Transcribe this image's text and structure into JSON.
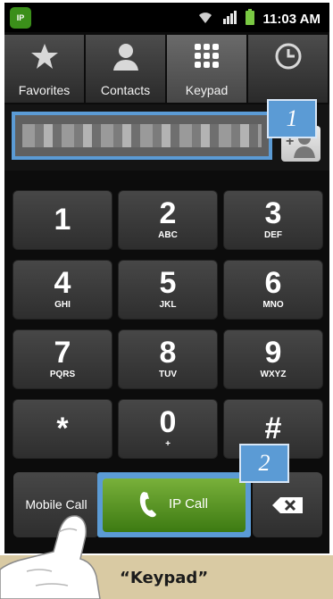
{
  "status_bar": {
    "app_badge": "IP",
    "icons": [
      "wifi-icon",
      "signal-icon",
      "battery-icon"
    ],
    "time": "11:03 AM"
  },
  "tabs": [
    {
      "label": "Favorites",
      "icon": "star-icon",
      "active": false
    },
    {
      "label": "Contacts",
      "icon": "person-icon",
      "active": false
    },
    {
      "label": "Keypad",
      "icon": "keypad-grid-icon",
      "active": true
    },
    {
      "label": "",
      "icon": "clock-icon",
      "active": false
    }
  ],
  "number_field": {
    "value": ""
  },
  "keypad": [
    {
      "digit": "1",
      "letters": ""
    },
    {
      "digit": "2",
      "letters": "ABC"
    },
    {
      "digit": "3",
      "letters": "DEF"
    },
    {
      "digit": "4",
      "letters": "GHI"
    },
    {
      "digit": "5",
      "letters": "JKL"
    },
    {
      "digit": "6",
      "letters": "MNO"
    },
    {
      "digit": "7",
      "letters": "PQRS"
    },
    {
      "digit": "8",
      "letters": "TUV"
    },
    {
      "digit": "9",
      "letters": "WXYZ"
    },
    {
      "digit": "*",
      "letters": ""
    },
    {
      "digit": "0",
      "letters": "+"
    },
    {
      "digit": "#",
      "letters": ""
    }
  ],
  "bottom": {
    "mobile_call": "Mobile Call",
    "ip_call": "IP Call"
  },
  "callouts": {
    "one": "1",
    "two": "2"
  },
  "caption": "“Keypad”",
  "colors": {
    "highlight": "#5b9bd5",
    "ip_call_green": "#5a9a25",
    "caption_bg": "#d9caa3"
  }
}
